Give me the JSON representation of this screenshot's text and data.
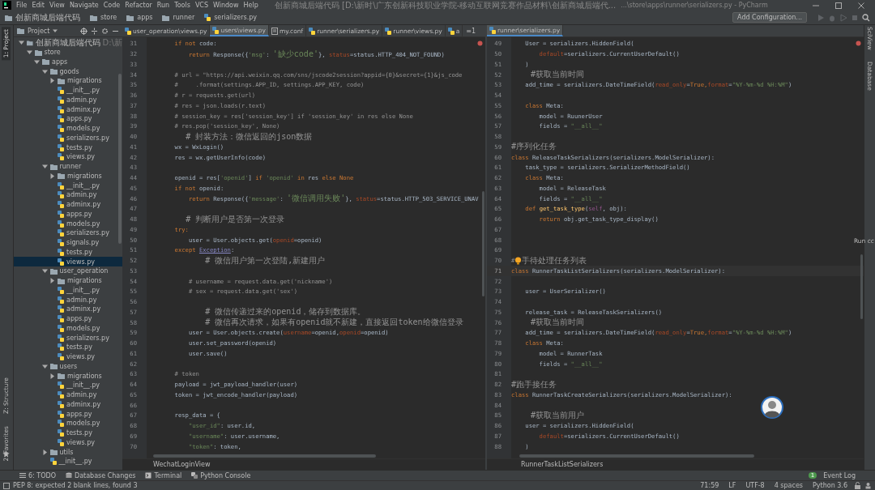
{
  "menu": [
    "File",
    "Edit",
    "View",
    "Navigate",
    "Code",
    "Refactor",
    "Run",
    "Tools",
    "VCS",
    "Window",
    "Help"
  ],
  "title": "创新商城后端代码 [D:\\新时\\广东创新科技职业学院-移动互联网竞赛作品材料\\创新商城后端代...",
  "title_path": "...\\store\\apps\\runner\\serializers.py - PyCharm",
  "breadcrumbs": [
    {
      "label": "创新商城后端代码",
      "kind": "folder"
    },
    {
      "label": "store",
      "kind": "folder"
    },
    {
      "label": "apps",
      "kind": "folder"
    },
    {
      "label": "runner",
      "kind": "folder"
    },
    {
      "label": "serializers.py",
      "kind": "file"
    }
  ],
  "run_config": "Add Configuration...",
  "project_panel": {
    "title": "Project"
  },
  "project_tree": [
    {
      "label": "创新商城后端代码",
      "path": "D:\\新",
      "kind": "folder",
      "expanded": true,
      "selected": false,
      "children": [
        {
          "label": "store",
          "kind": "folder",
          "expanded": true,
          "selected": false,
          "children": [
            {
              "label": "apps",
              "kind": "folder",
              "expanded": true,
              "selected": false,
              "children": [
                {
                  "label": "goods",
                  "kind": "folder",
                  "expanded": true,
                  "selected": false,
                  "children": [
                    {
                      "label": "migrations",
                      "kind": "folder",
                      "expanded": false,
                      "selected": false
                    },
                    {
                      "label": "__init__.py",
                      "kind": "file",
                      "selected": false
                    },
                    {
                      "label": "admin.py",
                      "kind": "file",
                      "selected": false
                    },
                    {
                      "label": "adminx.py",
                      "kind": "file",
                      "selected": false
                    },
                    {
                      "label": "apps.py",
                      "kind": "file",
                      "selected": false
                    },
                    {
                      "label": "models.py",
                      "kind": "file",
                      "selected": false
                    },
                    {
                      "label": "serializers.py",
                      "kind": "file",
                      "selected": false
                    },
                    {
                      "label": "tests.py",
                      "kind": "file",
                      "selected": false
                    },
                    {
                      "label": "views.py",
                      "kind": "file",
                      "selected": false
                    }
                  ]
                },
                {
                  "label": "runner",
                  "kind": "folder",
                  "expanded": true,
                  "selected": false,
                  "children": [
                    {
                      "label": "migrations",
                      "kind": "folder",
                      "expanded": false,
                      "selected": false
                    },
                    {
                      "label": "__init__.py",
                      "kind": "file",
                      "selected": false
                    },
                    {
                      "label": "admin.py",
                      "kind": "file",
                      "selected": false
                    },
                    {
                      "label": "adminx.py",
                      "kind": "file",
                      "selected": false
                    },
                    {
                      "label": "apps.py",
                      "kind": "file",
                      "selected": false
                    },
                    {
                      "label": "models.py",
                      "kind": "file",
                      "selected": false
                    },
                    {
                      "label": "serializers.py",
                      "kind": "file",
                      "selected": false
                    },
                    {
                      "label": "signals.py",
                      "kind": "file",
                      "selected": false
                    },
                    {
                      "label": "tests.py",
                      "kind": "file",
                      "selected": false
                    },
                    {
                      "label": "views.py",
                      "kind": "file",
                      "selected": true
                    }
                  ]
                },
                {
                  "label": "user_operation",
                  "kind": "folder",
                  "expanded": true,
                  "selected": false,
                  "children": [
                    {
                      "label": "migrations",
                      "kind": "folder",
                      "expanded": false,
                      "selected": false
                    },
                    {
                      "label": "__init__.py",
                      "kind": "file",
                      "selected": false
                    },
                    {
                      "label": "admin.py",
                      "kind": "file",
                      "selected": false
                    },
                    {
                      "label": "adminx.py",
                      "kind": "file",
                      "selected": false
                    },
                    {
                      "label": "apps.py",
                      "kind": "file",
                      "selected": false
                    },
                    {
                      "label": "models.py",
                      "kind": "file",
                      "selected": false
                    },
                    {
                      "label": "serializers.py",
                      "kind": "file",
                      "selected": false
                    },
                    {
                      "label": "tests.py",
                      "kind": "file",
                      "selected": false
                    },
                    {
                      "label": "views.py",
                      "kind": "file",
                      "selected": false
                    }
                  ]
                },
                {
                  "label": "users",
                  "kind": "folder",
                  "expanded": true,
                  "selected": false,
                  "children": [
                    {
                      "label": "migrations",
                      "kind": "folder",
                      "expanded": false,
                      "selected": false
                    },
                    {
                      "label": "__init__.py",
                      "kind": "file",
                      "selected": false
                    },
                    {
                      "label": "admin.py",
                      "kind": "file",
                      "selected": false
                    },
                    {
                      "label": "adminx.py",
                      "kind": "file",
                      "selected": false
                    },
                    {
                      "label": "apps.py",
                      "kind": "file",
                      "selected": false
                    },
                    {
                      "label": "models.py",
                      "kind": "file",
                      "selected": false
                    },
                    {
                      "label": "tests.py",
                      "kind": "file",
                      "selected": false
                    },
                    {
                      "label": "views.py",
                      "kind": "file",
                      "selected": false
                    }
                  ]
                },
                {
                  "label": "utils",
                  "kind": "folder",
                  "expanded": false,
                  "selected": false
                },
                {
                  "label": "__init__.py",
                  "kind": "file",
                  "selected": false
                }
              ]
            }
          ]
        }
      ]
    }
  ],
  "side_tabs": [
    {
      "label": "1: Project",
      "selected": true
    },
    {
      "label": "Z: Structure",
      "selected": false
    },
    {
      "label": "2: Favorites",
      "selected": false
    }
  ],
  "right_tabs": [
    "SciView",
    "Database"
  ],
  "run_hint": "Run cc",
  "left_editor": {
    "tabs": [
      {
        "label": "user_operation\\views.py",
        "kind": "py",
        "selected": false
      },
      {
        "label": "users\\views.py",
        "kind": "py",
        "selected": true
      },
      {
        "label": "my.conf",
        "kind": "conf",
        "selected": false
      },
      {
        "label": "runner\\serializers.py",
        "kind": "py",
        "selected": false
      },
      {
        "label": "runner\\views.py",
        "kind": "py",
        "selected": false
      },
      {
        "label": "a",
        "kind": "py",
        "selected": false
      }
    ],
    "overflow": "≡1",
    "crumb": "WechatLoginView",
    "lines": [
      {
        "n": "31",
        "current": false,
        "tokens": [
          {
            "text": "        if not",
            "kind": "kw"
          },
          {
            "text": " code:",
            "kind": "plain"
          }
        ]
      },
      {
        "n": "32",
        "current": false,
        "tokens": [
          {
            "text": "            return",
            "kind": "kw"
          },
          {
            "text": " Response({",
            "kind": "plain"
          },
          {
            "text": "'msg'",
            "kind": "str"
          },
          {
            "text": ": ",
            "kind": "plain"
          },
          {
            "text": "'缺少code'",
            "kind": "strzh"
          },
          {
            "text": "}, ",
            "kind": "plain"
          },
          {
            "text": "status",
            "kind": "param"
          },
          {
            "text": "=status.HTTP_404_NOT_FOUND)",
            "kind": "plain"
          }
        ]
      },
      {
        "n": "33",
        "current": false
      },
      {
        "n": "34",
        "current": false,
        "tokens": [
          {
            "text": "        # url = \"https://api.weixin.qq.com/sns/jscode2session?appid={0}&secret={1}&js_code",
            "kind": "cmt"
          }
        ]
      },
      {
        "n": "35",
        "current": false,
        "tokens": [
          {
            "text": "        #     .format(settings.APP_ID, settings.APP_KEY, code)",
            "kind": "cmt"
          }
        ]
      },
      {
        "n": "36",
        "current": false,
        "tokens": [
          {
            "text": "        # r = requests.get(url)",
            "kind": "cmt"
          }
        ]
      },
      {
        "n": "37",
        "current": false,
        "tokens": [
          {
            "text": "        # res = json.loads(r.text)",
            "kind": "cmt"
          }
        ]
      },
      {
        "n": "38",
        "current": false,
        "tokens": [
          {
            "text": "        # session_key = res['session_key'] if 'session_key' in res else None",
            "kind": "cmt"
          }
        ]
      },
      {
        "n": "39",
        "current": false,
        "tokens": [
          {
            "text": "        # res.pop('session_key', None)",
            "kind": "cmt"
          }
        ]
      },
      {
        "n": "40",
        "current": false,
        "tokens": [
          {
            "text": "        # 封装方法：微信返回的json数据",
            "kind": "cmtzh"
          }
        ]
      },
      {
        "n": "41",
        "current": false,
        "tokens": [
          {
            "text": "        wx = WxLogin()",
            "kind": "plain"
          }
        ]
      },
      {
        "n": "42",
        "current": false,
        "tokens": [
          {
            "text": "        res = wx.getUserInfo(code)",
            "kind": "plain"
          }
        ]
      },
      {
        "n": "43",
        "current": false
      },
      {
        "n": "44",
        "current": false,
        "tokens": [
          {
            "text": "        openid = res[",
            "kind": "plain"
          },
          {
            "text": "'openid'",
            "kind": "str"
          },
          {
            "text": "] ",
            "kind": "plain"
          },
          {
            "text": "if",
            "kind": "kw"
          },
          {
            "text": " 'openid'",
            "kind": "str"
          },
          {
            "text": " in",
            "kind": "kw"
          },
          {
            "text": " res ",
            "kind": "plain"
          },
          {
            "text": "else None",
            "kind": "kw"
          }
        ]
      },
      {
        "n": "45",
        "current": false,
        "tokens": [
          {
            "text": "        if not",
            "kind": "kw"
          },
          {
            "text": " openid:",
            "kind": "plain"
          }
        ]
      },
      {
        "n": "46",
        "current": false,
        "tokens": [
          {
            "text": "            return",
            "kind": "kw"
          },
          {
            "text": " Response({",
            "kind": "plain"
          },
          {
            "text": "'message'",
            "kind": "str"
          },
          {
            "text": ": ",
            "kind": "plain"
          },
          {
            "text": "'微信调用失败'",
            "kind": "strzh"
          },
          {
            "text": "}, ",
            "kind": "plain"
          },
          {
            "text": "status",
            "kind": "param"
          },
          {
            "text": "=status.HTTP_503_SERVICE_UNAV",
            "kind": "plain"
          }
        ]
      },
      {
        "n": "47",
        "current": false
      },
      {
        "n": "48",
        "current": false,
        "tokens": [
          {
            "text": "        # 判断用户是否第一次登录",
            "kind": "cmtzh"
          }
        ]
      },
      {
        "n": "49",
        "current": false,
        "tokens": [
          {
            "text": "        try:",
            "kind": "kw"
          }
        ]
      },
      {
        "n": "50",
        "current": false,
        "tokens": [
          {
            "text": "            user = User.objects.get(",
            "kind": "plain"
          },
          {
            "text": "openid",
            "kind": "param"
          },
          {
            "text": "=openid)",
            "kind": "plain"
          }
        ]
      },
      {
        "n": "51",
        "current": false,
        "tokens": [
          {
            "text": "        except ",
            "kind": "kw"
          },
          {
            "text": "Exception",
            "kind": "builtin"
          },
          {
            "text": ":",
            "kind": "plain"
          }
        ]
      },
      {
        "n": "52",
        "current": false,
        "tokens": [
          {
            "text": "            # 微信用户第一次登陆,新建用户",
            "kind": "cmtzh"
          }
        ]
      },
      {
        "n": "53",
        "current": false
      },
      {
        "n": "54",
        "current": false,
        "tokens": [
          {
            "text": "            # username = request.data.get('nickname')",
            "kind": "cmt"
          }
        ]
      },
      {
        "n": "55",
        "current": false,
        "tokens": [
          {
            "text": "            # sex = request.data.get('sex')",
            "kind": "cmt"
          }
        ]
      },
      {
        "n": "56",
        "current": false
      },
      {
        "n": "57",
        "current": false,
        "tokens": [
          {
            "text": "            # 微信传递过来的openid，储存到数据库。",
            "kind": "cmtzh"
          }
        ]
      },
      {
        "n": "58",
        "current": false,
        "tokens": [
          {
            "text": "            # 微信再次请求，如果有openid就不新建，直接返回token给微信登录",
            "kind": "cmtzh"
          }
        ]
      },
      {
        "n": "59",
        "current": false,
        "tokens": [
          {
            "text": "            user = User.objects.create(",
            "kind": "plain"
          },
          {
            "text": "username",
            "kind": "param"
          },
          {
            "text": "=openid,",
            "kind": "plain"
          },
          {
            "text": "openid",
            "kind": "param"
          },
          {
            "text": "=openid)",
            "kind": "plain"
          }
        ]
      },
      {
        "n": "60",
        "current": false,
        "tokens": [
          {
            "text": "            user.set_password(openid)",
            "kind": "plain"
          }
        ]
      },
      {
        "n": "61",
        "current": false,
        "tokens": [
          {
            "text": "            user.save()",
            "kind": "plain"
          }
        ]
      },
      {
        "n": "62",
        "current": false
      },
      {
        "n": "63",
        "current": false,
        "tokens": [
          {
            "text": "        # token",
            "kind": "cmt"
          }
        ]
      },
      {
        "n": "64",
        "current": false,
        "tokens": [
          {
            "text": "        payload = jwt_payload_handler(user)",
            "kind": "plain"
          }
        ]
      },
      {
        "n": "65",
        "current": false,
        "tokens": [
          {
            "text": "        token = jwt_encode_handler(payload)",
            "kind": "plain"
          }
        ]
      },
      {
        "n": "66",
        "current": false
      },
      {
        "n": "67",
        "current": false,
        "tokens": [
          {
            "text": "        resp_data = {",
            "kind": "plain"
          }
        ]
      },
      {
        "n": "68",
        "current": false,
        "tokens": [
          {
            "text": "            \"user_id\"",
            "kind": "str"
          },
          {
            "text": ": user.id,",
            "kind": "plain"
          }
        ]
      },
      {
        "n": "69",
        "current": false,
        "tokens": [
          {
            "text": "            \"username\"",
            "kind": "str"
          },
          {
            "text": ": user.username,",
            "kind": "plain"
          }
        ]
      },
      {
        "n": "70",
        "current": false,
        "tokens": [
          {
            "text": "            \"token\"",
            "kind": "str"
          },
          {
            "text": ": token,",
            "kind": "plain"
          }
        ]
      }
    ]
  },
  "right_editor": {
    "tabs": [
      {
        "label": "runner\\serializers.py",
        "kind": "py",
        "selected": true
      }
    ],
    "crumb": "RunnerTaskListSerializers",
    "lines": [
      {
        "n": "49",
        "current": false,
        "tokens": [
          {
            "text": "    User = serializers.HiddenField(",
            "kind": "plain"
          }
        ]
      },
      {
        "n": "50",
        "current": false,
        "tokens": [
          {
            "text": "        default",
            "kind": "param"
          },
          {
            "text": "=serializers.CurrentUserDefault()",
            "kind": "plain"
          }
        ]
      },
      {
        "n": "51",
        "current": false,
        "tokens": [
          {
            "text": "    )",
            "kind": "plain"
          }
        ]
      },
      {
        "n": "52",
        "current": false,
        "tokens": [
          {
            "text": "    #获取当前时间",
            "kind": "cmtzh"
          }
        ]
      },
      {
        "n": "53",
        "current": false,
        "tokens": [
          {
            "text": "    add_time = serializers.DateTimeField(",
            "kind": "plain"
          },
          {
            "text": "read_only",
            "kind": "param"
          },
          {
            "text": "=",
            "kind": "plain"
          },
          {
            "text": "True,",
            "kind": "kw"
          },
          {
            "text": "format",
            "kind": "param"
          },
          {
            "text": "=",
            "kind": "plain"
          },
          {
            "text": "\"%Y-%m-%d %H:%M\"",
            "kind": "str"
          },
          {
            "text": ")",
            "kind": "plain"
          }
        ]
      },
      {
        "n": "54",
        "current": false
      },
      {
        "n": "55",
        "current": false,
        "tokens": [
          {
            "text": "    class",
            "kind": "kw"
          },
          {
            "text": " Meta:",
            "kind": "plain"
          }
        ]
      },
      {
        "n": "56",
        "current": false,
        "tokens": [
          {
            "text": "        model = RuunerUser",
            "kind": "plain"
          }
        ]
      },
      {
        "n": "57",
        "current": false,
        "tokens": [
          {
            "text": "        fields = ",
            "kind": "plain"
          },
          {
            "text": "\"__all__\"",
            "kind": "str"
          }
        ]
      },
      {
        "n": "58",
        "current": false
      },
      {
        "n": "59",
        "current": false,
        "tokens": [
          {
            "text": "#序列化任务",
            "kind": "cmtzh"
          }
        ]
      },
      {
        "n": "60",
        "current": false,
        "tokens": [
          {
            "text": "class",
            "kind": "kw"
          },
          {
            "text": " ReleaseTaskSerializers(serializers.ModelSerializer):",
            "kind": "plain"
          }
        ]
      },
      {
        "n": "61",
        "current": false,
        "tokens": [
          {
            "text": "    task_type = serializers.SerializerMethodField()",
            "kind": "plain"
          }
        ]
      },
      {
        "n": "62",
        "current": false,
        "tokens": [
          {
            "text": "    class",
            "kind": "kw"
          },
          {
            "text": " Meta:",
            "kind": "plain"
          }
        ]
      },
      {
        "n": "63",
        "current": false,
        "tokens": [
          {
            "text": "        model = ReleaseTask",
            "kind": "plain"
          }
        ]
      },
      {
        "n": "64",
        "current": false,
        "tokens": [
          {
            "text": "        fields = ",
            "kind": "plain"
          },
          {
            "text": "\"__all__\"",
            "kind": "str"
          }
        ]
      },
      {
        "n": "65",
        "current": false,
        "tokens": [
          {
            "text": "    def ",
            "kind": "kw"
          },
          {
            "text": "get_task_type",
            "kind": "fn"
          },
          {
            "text": "(",
            "kind": "plain"
          },
          {
            "text": "self",
            "kind": "self"
          },
          {
            "text": ", obj):",
            "kind": "plain"
          }
        ]
      },
      {
        "n": "66",
        "current": false,
        "tokens": [
          {
            "text": "        return",
            "kind": "kw"
          },
          {
            "text": " obj.get_task_type_display()",
            "kind": "plain"
          }
        ]
      },
      {
        "n": "67",
        "current": false
      },
      {
        "n": "68",
        "current": false
      },
      {
        "n": "69",
        "current": false
      },
      {
        "n": "70",
        "current": false,
        "bulb": true,
        "tokens": [
          {
            "text": "#",
            "kind": "cmt"
          },
          {
            "text": "手待处理任务列表",
            "kind": "cmtzh"
          }
        ]
      },
      {
        "n": "71",
        "current": true,
        "tokens": [
          {
            "text": "class",
            "kind": "kw"
          },
          {
            "text": " RunnerTaskListSerializers(serializers.ModelSerializer):",
            "kind": "plain"
          }
        ]
      },
      {
        "n": "72",
        "current": false
      },
      {
        "n": "73",
        "current": false,
        "tokens": [
          {
            "text": "    user = UserSerializer()",
            "kind": "plain"
          }
        ]
      },
      {
        "n": "74",
        "current": false
      },
      {
        "n": "75",
        "current": false,
        "tokens": [
          {
            "text": "    release_task = ReleaseTaskSerializers()",
            "kind": "plain"
          }
        ]
      },
      {
        "n": "76",
        "current": false,
        "tokens": [
          {
            "text": "    #获取当前时间",
            "kind": "cmtzh"
          }
        ]
      },
      {
        "n": "77",
        "current": false,
        "tokens": [
          {
            "text": "    add_time = serializers.DateTimeField(",
            "kind": "plain"
          },
          {
            "text": "read_only",
            "kind": "param"
          },
          {
            "text": "=",
            "kind": "plain"
          },
          {
            "text": "True,",
            "kind": "kw"
          },
          {
            "text": "format",
            "kind": "param"
          },
          {
            "text": "=",
            "kind": "plain"
          },
          {
            "text": "\"%Y-%m-%d %H:%M\"",
            "kind": "str"
          },
          {
            "text": ")",
            "kind": "plain"
          }
        ]
      },
      {
        "n": "78",
        "current": false,
        "tokens": [
          {
            "text": "    class",
            "kind": "kw"
          },
          {
            "text": " Meta:",
            "kind": "plain"
          }
        ]
      },
      {
        "n": "79",
        "current": false,
        "tokens": [
          {
            "text": "        model = RunnerTask",
            "kind": "plain"
          }
        ]
      },
      {
        "n": "80",
        "current": false,
        "tokens": [
          {
            "text": "        fields = ",
            "kind": "plain"
          },
          {
            "text": "\"__all__\"",
            "kind": "str"
          }
        ]
      },
      {
        "n": "81",
        "current": false
      },
      {
        "n": "82",
        "current": false,
        "tokens": [
          {
            "text": "#跑手接任务",
            "kind": "cmtzh"
          }
        ]
      },
      {
        "n": "83",
        "current": false,
        "tokens": [
          {
            "text": "class",
            "kind": "kw"
          },
          {
            "text": " RunnerTaskCreateSerializers(serializers.ModelSerializer):",
            "kind": "plain"
          }
        ]
      },
      {
        "n": "84",
        "current": false
      },
      {
        "n": "85",
        "current": false,
        "tokens": [
          {
            "text": "    #获取当前用户",
            "kind": "cmtzh"
          }
        ]
      },
      {
        "n": "86",
        "current": false,
        "tokens": [
          {
            "text": "    user = serializers.HiddenField(",
            "kind": "plain"
          }
        ]
      },
      {
        "n": "87",
        "current": false,
        "tokens": [
          {
            "text": "        default",
            "kind": "param"
          },
          {
            "text": "=serializers.CurrentUserDefault()",
            "kind": "plain"
          }
        ]
      },
      {
        "n": "88",
        "current": false,
        "tokens": [
          {
            "text": "    )",
            "kind": "plain"
          }
        ]
      }
    ]
  },
  "tool_windows": [
    {
      "label": "6: TODO",
      "kind": "todo"
    },
    {
      "label": "Database Changes",
      "kind": "db"
    },
    {
      "label": "Terminal",
      "kind": "terminal"
    },
    {
      "label": "Python Console",
      "kind": "console"
    }
  ],
  "event_log": {
    "label": "Event Log",
    "count": "1"
  },
  "status_message": "PEP 8: expected 2 blank lines, found 3",
  "status_items": [
    "71:59",
    "LF",
    "UTF-8",
    "4 spaces",
    "Python 3.6"
  ]
}
